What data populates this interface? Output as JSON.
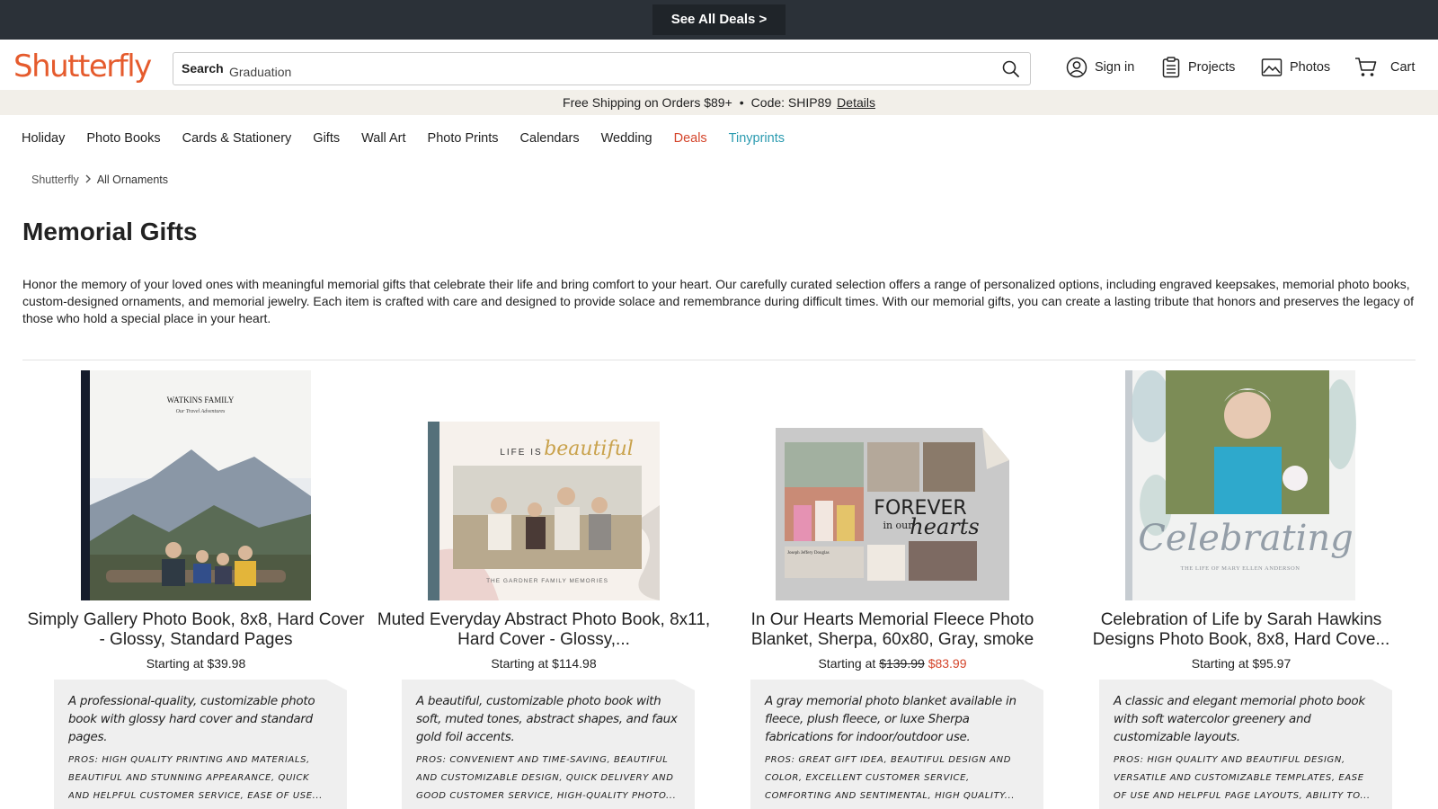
{
  "promo": {
    "deals_label": "See All Deals >"
  },
  "header": {
    "logo": "Shutterfly",
    "search_label": "Search",
    "search_value": "Graduation",
    "nav": {
      "sign_in": "Sign in",
      "projects": "Projects",
      "photos": "Photos",
      "cart": "Cart"
    }
  },
  "shipping": {
    "text": "Free Shipping on Orders $89+",
    "code": "Code: SHIP89",
    "details": "Details"
  },
  "main_nav": [
    "Holiday",
    "Photo Books",
    "Cards & Stationery",
    "Gifts",
    "Wall Art",
    "Photo Prints",
    "Calendars",
    "Wedding",
    "Deals",
    "Tinyprints"
  ],
  "breadcrumb": {
    "home": "Shutterfly",
    "current": "All Ornaments"
  },
  "page": {
    "title": "Memorial Gifts",
    "intro": "Honor the memory of your loved ones with meaningful memorial gifts that celebrate their life and bring comfort to your heart. Our carefully curated selection offers a range of personalized options, including engraved keepsakes, memorial photo books, custom-designed ornaments, and memorial jewelry. Each item is crafted with care and designed to provide solace and remembrance during difficult times. With our memorial gifts, you can create a lasting tribute that honors and preserves the legacy of those who hold a special place in your heart."
  },
  "products": [
    {
      "title": "Simply Gallery Photo Book, 8x8, Hard Cover - Glossy, Standard Pages",
      "price_prefix": "Starting at",
      "price": "$39.98",
      "desc": "A professional-quality, customizable photo book with glossy hard cover and standard pages.",
      "pros": "Pros: High quality printing and materials, beautiful and stunning appearance, quick and helpful customer service, ease of use...",
      "cover_text": "WATKINS FAMILY",
      "cover_sub": "Our Travel Adventures"
    },
    {
      "title": "Muted Everyday Abstract Photo Book, 8x11, Hard Cover - Glossy,...",
      "price_prefix": "Starting at",
      "price": "$114.98",
      "desc": "A beautiful, customizable photo book with soft, muted tones, abstract shapes, and faux gold foil accents.",
      "pros": "Pros: Convenient and time-saving, beautiful and customizable design, quick delivery and good customer service, high-quality photo...",
      "cover_text": "LIFE IS",
      "cover_script": "beautiful",
      "cover_sub": "THE GARDNER FAMILY MEMORIES"
    },
    {
      "title": "In Our Hearts Memorial Fleece Photo Blanket, Sherpa, 60x80, Gray, smoke",
      "price_prefix": "Starting at",
      "price_old": "$139.99",
      "price_sale": "$83.99",
      "desc": "A gray memorial photo blanket available in fleece, plush fleece, or luxe Sherpa fabrications for indoor/outdoor use.",
      "pros": "Pros: Great gift idea, beautiful design and color, excellent customer service, comforting and sentimental, high quality...",
      "cover_text": "FOREVER",
      "cover_mid": "in our",
      "cover_script": "hearts",
      "cover_sub": "Joseph Jeffery Douglas"
    },
    {
      "title": "Celebration of Life by Sarah Hawkins Designs Photo Book, 8x8, Hard Cove...",
      "price_prefix": "Starting at",
      "price": "$95.97",
      "desc": "A classic and elegant memorial photo book with soft watercolor greenery and customizable layouts.",
      "pros": "Pros: High quality and beautiful design, versatile and customizable templates, ease of use and helpful page layouts, ability to...",
      "cover_script": "Celebrating",
      "cover_sub": "THE LIFE OF MARY ELLEN ANDERSON"
    }
  ],
  "colors": {
    "promo_bg": "#2b3138",
    "brand": "#e55b2d",
    "deals": "#d4452b",
    "tinyprints": "#2b9bb0",
    "ship_bg": "#f2efe9"
  }
}
